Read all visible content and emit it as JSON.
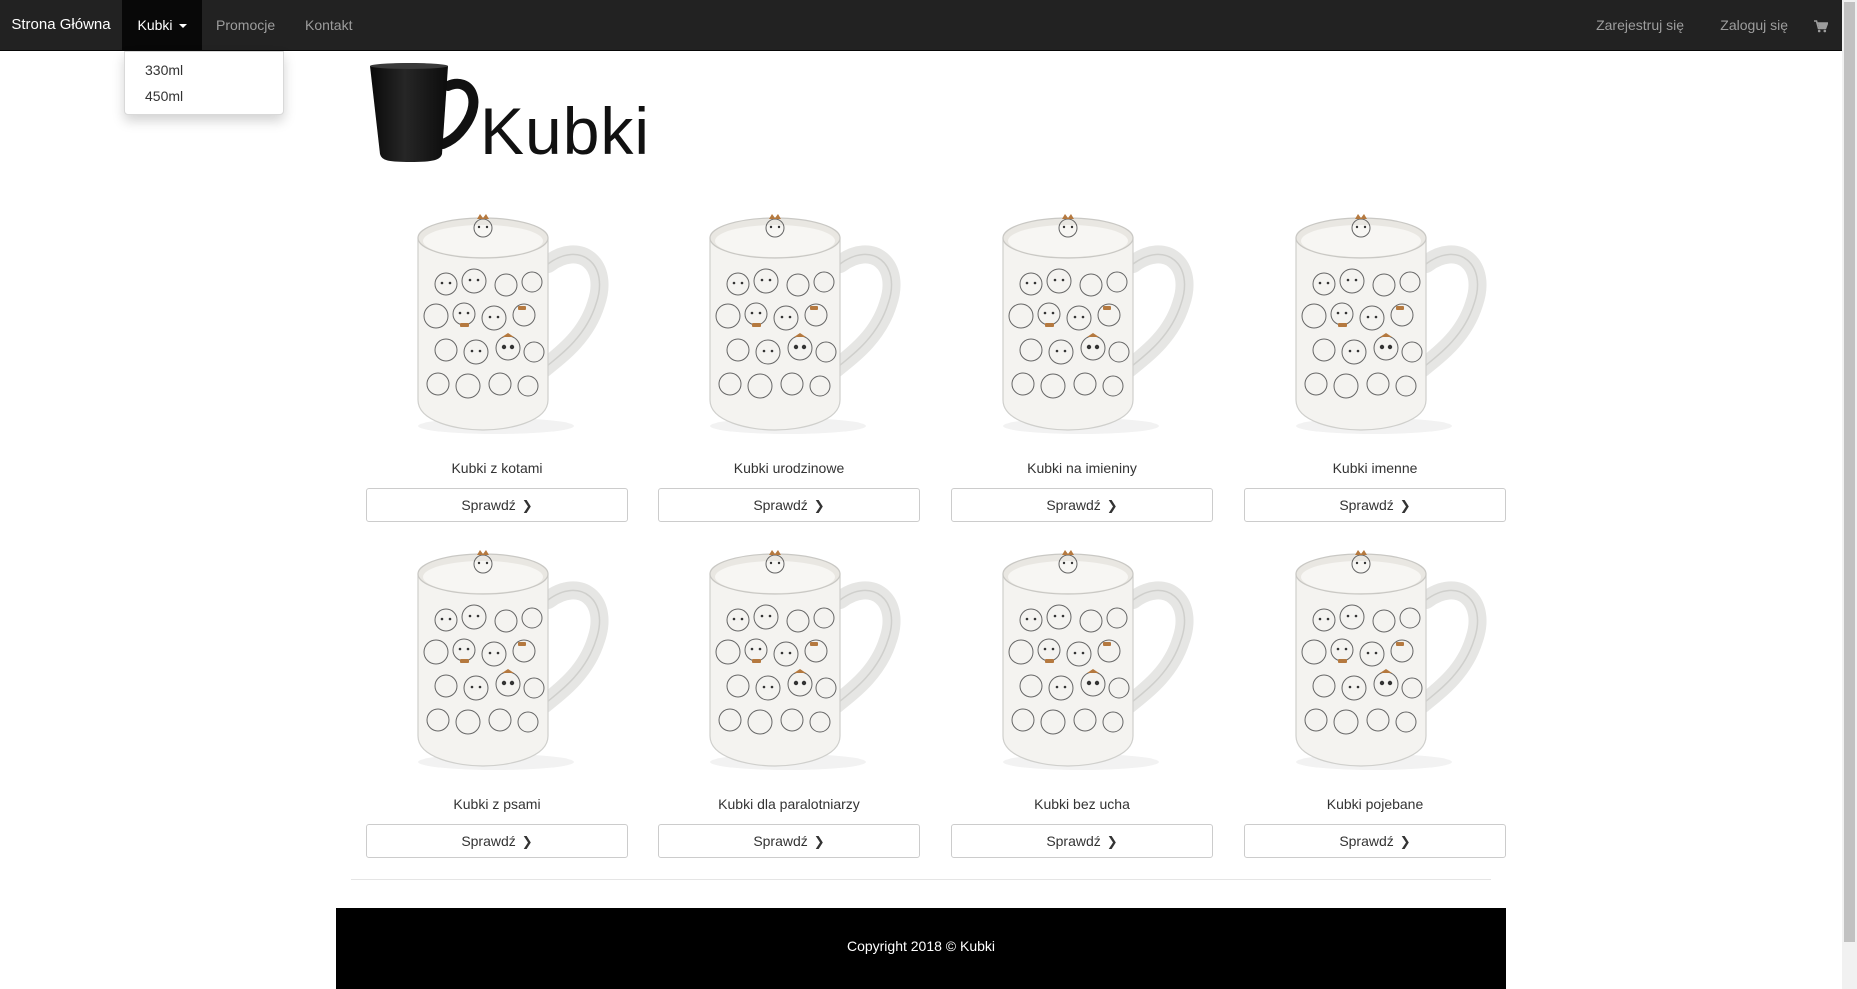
{
  "navbar": {
    "brand": "Strona Główna",
    "dropdown_label": "Kubki",
    "promo": "Promocje",
    "contact": "Kontakt",
    "register": "Zarejestruj się",
    "login": "Zaloguj się",
    "cart_icon": "shopping-cart-icon"
  },
  "dropdown": {
    "items": [
      {
        "label": "330ml"
      },
      {
        "label": "450ml"
      }
    ]
  },
  "logo": {
    "text": "Kubki",
    "icon": "mug-icon"
  },
  "products": [
    {
      "title": "Kubki z kotami",
      "button": "Sprawdź"
    },
    {
      "title": "Kubki urodzinowe",
      "button": "Sprawdź"
    },
    {
      "title": "Kubki na imieniny",
      "button": "Sprawdź"
    },
    {
      "title": "Kubki imenne",
      "button": "Sprawdź"
    },
    {
      "title": "Kubki z psami",
      "button": "Sprawdź"
    },
    {
      "title": "Kubki dla paralotniarzy",
      "button": "Sprawdź"
    },
    {
      "title": "Kubki bez ucha",
      "button": "Sprawdź"
    },
    {
      "title": "Kubki pojebane",
      "button": "Sprawdź"
    }
  ],
  "footer": {
    "copyright": "Copyright 2018 © Kubki"
  },
  "colors": {
    "navbar_bg": "#222222",
    "navbar_active_bg": "#080808",
    "footer_bg": "#000000"
  }
}
